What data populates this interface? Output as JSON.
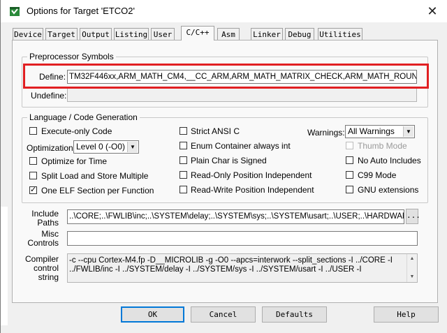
{
  "window": {
    "title": "Options for Target 'ETCO2'",
    "app_icon": "keil-uvision-icon",
    "close_glyph": "✕"
  },
  "tabs": [
    {
      "label": "Device"
    },
    {
      "label": "Target"
    },
    {
      "label": "Output"
    },
    {
      "label": "Listing"
    },
    {
      "label": "User"
    },
    {
      "label": "C/C++"
    },
    {
      "label": "Asm"
    },
    {
      "label": "Linker"
    },
    {
      "label": "Debug"
    },
    {
      "label": "Utilities"
    }
  ],
  "active_tab": "C/C++",
  "preprocessor": {
    "legend": "Preprocessor Symbols",
    "define_label": "Define:",
    "define_value": "TM32F446xx,ARM_MATH_CM4,__CC_ARM,ARM_MATH_MATRIX_CHECK,ARM_MATH_ROUNDING",
    "undefine_label": "Undefine:",
    "undefine_value": ""
  },
  "language": {
    "legend": "Language / Code Generation",
    "execute_only": {
      "label": "Execute-only Code",
      "checked": false
    },
    "optimization_label": "Optimization:",
    "optimization_value": "Level 0 (-O0)",
    "optimize_time": {
      "label": "Optimize for Time",
      "checked": false
    },
    "split_load": {
      "label": "Split Load and Store Multiple",
      "checked": false
    },
    "one_elf": {
      "label": "One ELF Section per Function",
      "checked": true
    },
    "strict_ansi": {
      "label": "Strict ANSI C",
      "checked": false
    },
    "enum_container": {
      "label": "Enum Container always int",
      "checked": false
    },
    "plain_char": {
      "label": "Plain Char is Signed",
      "checked": false
    },
    "ro_pos": {
      "label": "Read-Only Position Independent",
      "checked": false
    },
    "rw_pos": {
      "label": "Read-Write Position Independent",
      "checked": false
    },
    "warnings_label": "Warnings:",
    "warnings_value": "All Warnings",
    "thumb_mode": {
      "label": "Thumb Mode",
      "checked": false,
      "disabled": true
    },
    "no_auto_includes": {
      "label": "No Auto Includes",
      "checked": false
    },
    "c99_mode": {
      "label": "C99 Mode",
      "checked": false
    },
    "gnu_extensions": {
      "label": "GNU extensions",
      "checked": false
    }
  },
  "include_paths": {
    "label_line1": "Include",
    "label_line2": "Paths",
    "value": "..\\CORE;..\\FWLIB\\inc;..\\SYSTEM\\delay;..\\SYSTEM\\sys;..\\SYSTEM\\usart;..\\USER;..\\HARDWARE",
    "browse_label": "..."
  },
  "misc_controls": {
    "label_line1": "Misc",
    "label_line2": "Controls",
    "value": ""
  },
  "compiler_control": {
    "label_line1": "Compiler",
    "label_line2": "control",
    "label_line3": "string",
    "line1": "-c --cpu Cortex-M4.fp -D__MICROLIB -g -O0 --apcs=interwork --split_sections -I ../CORE -I",
    "line2": "../FWLIB/inc -I ../SYSTEM/delay -I ../SYSTEM/sys -I ../SYSTEM/usart -I ../USER -I"
  },
  "buttons": {
    "ok": "OK",
    "cancel": "Cancel",
    "defaults": "Defaults",
    "help": "Help"
  },
  "colors": {
    "highlight": "#e11f22",
    "default_button_border": "#0078d7"
  }
}
